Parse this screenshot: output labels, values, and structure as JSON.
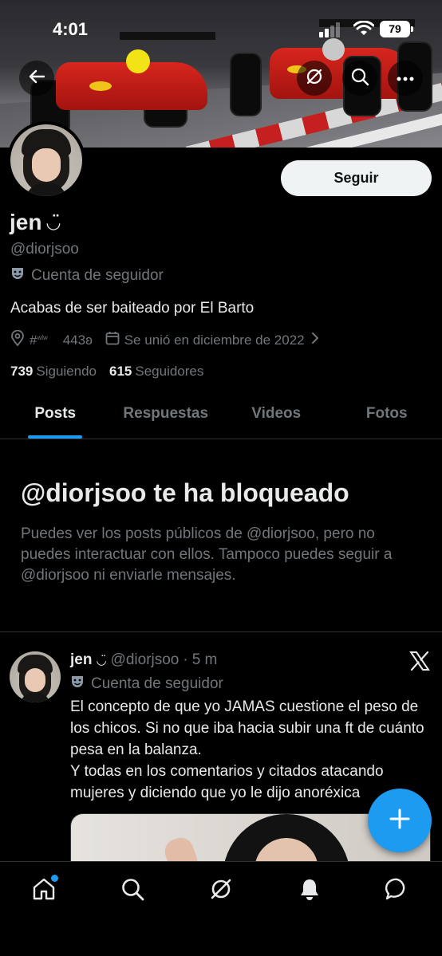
{
  "status_bar": {
    "time": "4:01",
    "battery": "79"
  },
  "profile": {
    "name": "jen",
    "name_emoji": "◡̈",
    "handle": "@diorjsoo",
    "parody_label": "Cuenta de seguidor",
    "follow_label": "Seguir",
    "bio": "Acabas de ser baiteado por El Barto",
    "location": "#",
    "location_sup": "wlw",
    "location_rest": "443ʚ",
    "joined": "Se unió en diciembre de 2022",
    "following_count": "739",
    "following_label": "Siguiendo",
    "followers_count": "615",
    "followers_label": "Seguidores"
  },
  "tabs": [
    {
      "label": "Posts",
      "active": true
    },
    {
      "label": "Respuestas",
      "active": false
    },
    {
      "label": "Videos",
      "active": false
    },
    {
      "label": "Fotos",
      "active": false
    }
  ],
  "blocked": {
    "title": "@diorjsoo te ha bloqueado",
    "text": "Puedes ver los posts públicos de @diorjsoo, pero no puedes interactuar con ellos. Tampoco puedes seguir a @diorjsoo ni enviarle mensajes."
  },
  "post": {
    "name": "jen",
    "name_emoji": "◡̈",
    "handle": "@diorjsoo",
    "separator": "·",
    "time": "5 m",
    "parody_label": "Cuenta de seguidor",
    "text": "El concepto de que yo JAMAS cuestione el peso de los chicos. Si no que iba hacia subir una ft de cuánto pesa en la balanza.\nY todas en los comentarios y citados atacando mujeres y diciendo que yo le dijo anoréxica"
  },
  "icons": {
    "back": "back-arrow-icon",
    "grok": "grok-icon",
    "search": "search-icon",
    "more": "more-icon",
    "location": "location-pin-icon",
    "calendar": "calendar-icon",
    "parody": "theater-mask-icon",
    "x_logo": "x-logo-icon",
    "compose": "plus-icon",
    "home": "home-icon",
    "nav_search": "search-icon",
    "nav_grok": "grok-icon",
    "notifications": "bell-icon",
    "messages": "chat-icon"
  },
  "colors": {
    "accent": "#1d9bf0",
    "text_primary": "#e7e9ea",
    "text_secondary": "#71767b",
    "background": "#000000"
  }
}
